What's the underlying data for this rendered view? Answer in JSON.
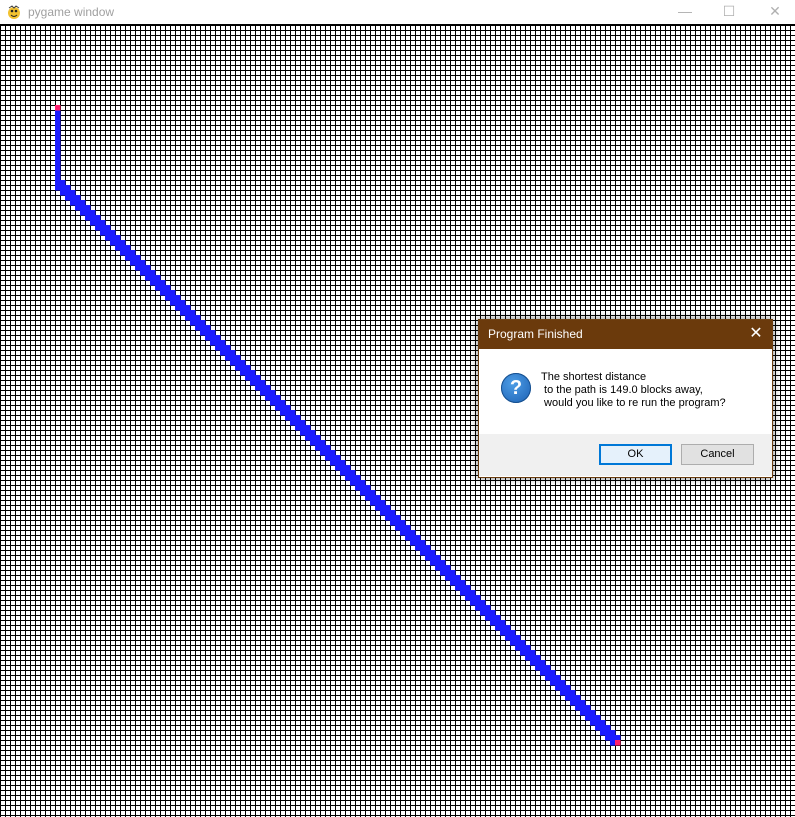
{
  "window": {
    "title": "pygame window",
    "minimize": "—",
    "maximize": "☐",
    "close": "✕",
    "icon": "pygame-snake-icon"
  },
  "grid": {
    "cell_color": "#ffffff",
    "line_color": "#000000",
    "path_color": "#1a1aff",
    "endpoint_color": "#ff1f6e"
  },
  "dialog": {
    "title": "Program Finished",
    "close_label": "✕",
    "icon": "question-icon",
    "icon_glyph": "?",
    "message": "The shortest distance\n to the path is 149.0 blocks away,\n would you like to re run the program?",
    "ok_label": "OK",
    "cancel_label": "Cancel"
  }
}
